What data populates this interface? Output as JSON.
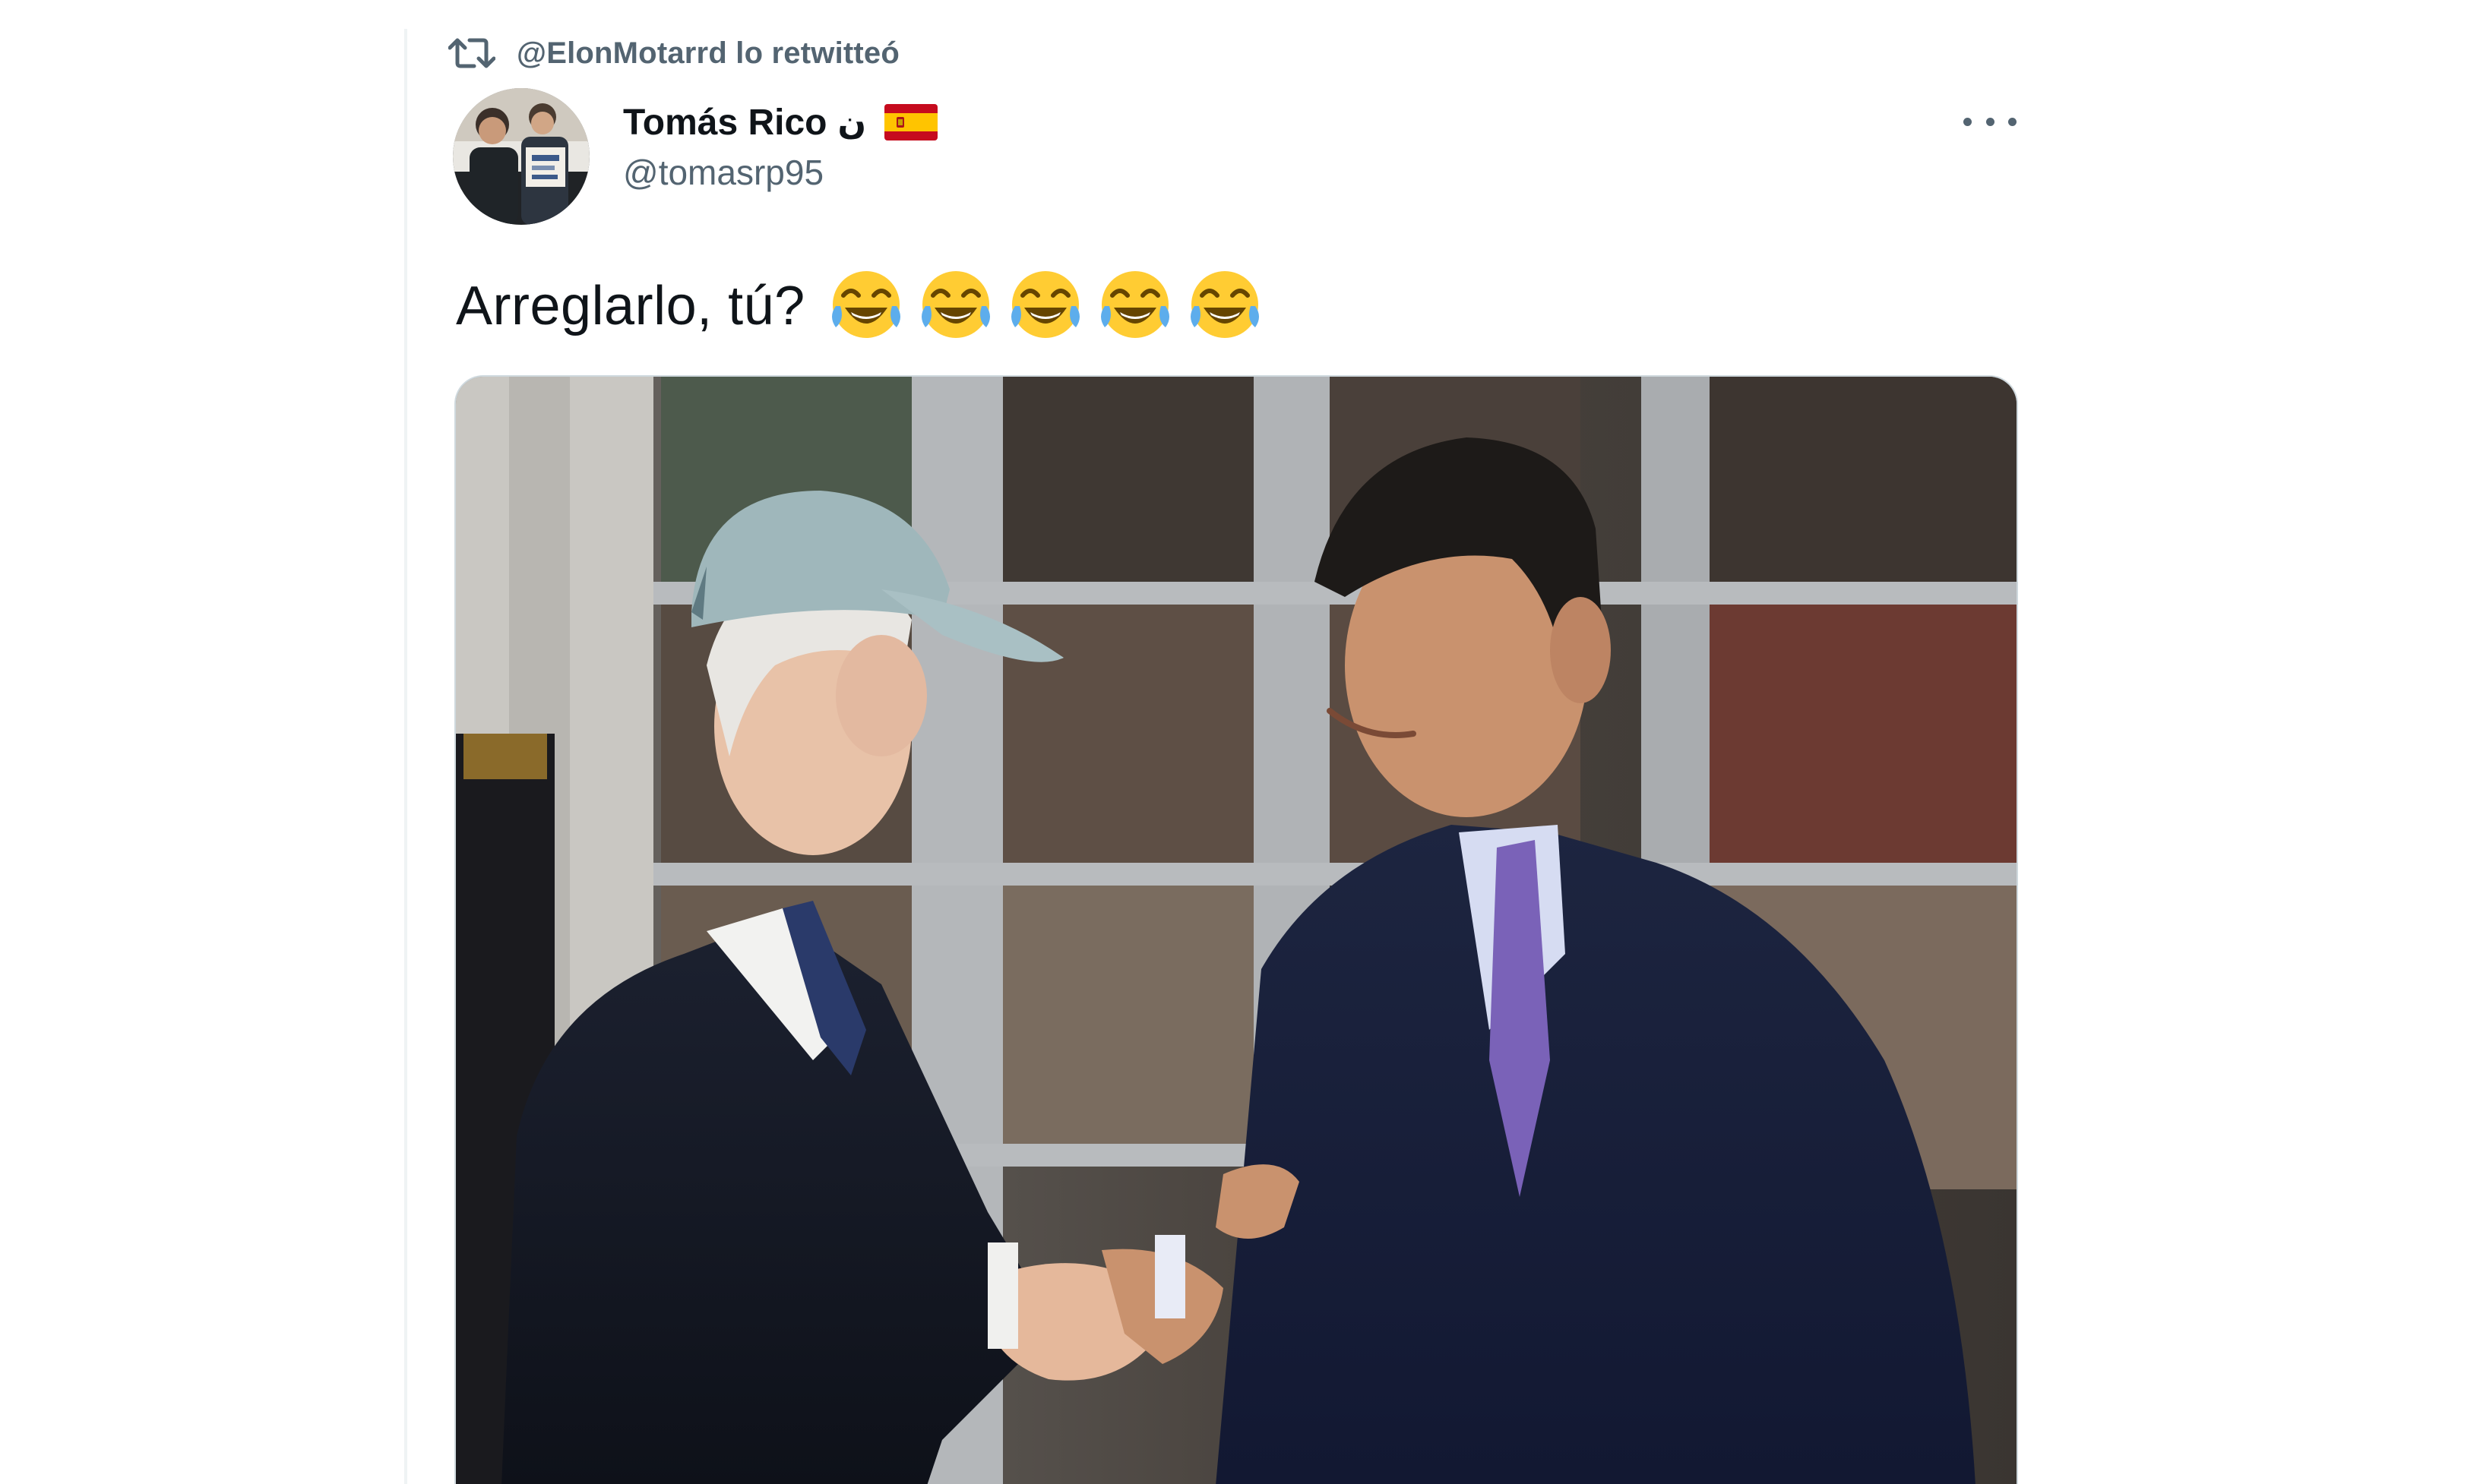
{
  "retweet": {
    "icon": "retweet-icon",
    "text": "@ElonMotarrd lo retwitteó"
  },
  "author": {
    "display_name": "Tomás Rico",
    "name_glyph": "ن",
    "flag": "spain-flag-icon",
    "handle": "@tomasrp95"
  },
  "tweet": {
    "text": "Arreglarlo, tú?",
    "emoji": [
      "face-with-tears-of-joy-icon",
      "face-with-tears-of-joy-icon",
      "face-with-tears-of-joy-icon",
      "face-with-tears-of-joy-icon",
      "face-with-tears-of-joy-icon"
    ]
  },
  "media": {
    "type": "photo"
  },
  "colors": {
    "text_primary": "#0f1419",
    "text_secondary": "#536471",
    "border": "#cfd9de"
  }
}
